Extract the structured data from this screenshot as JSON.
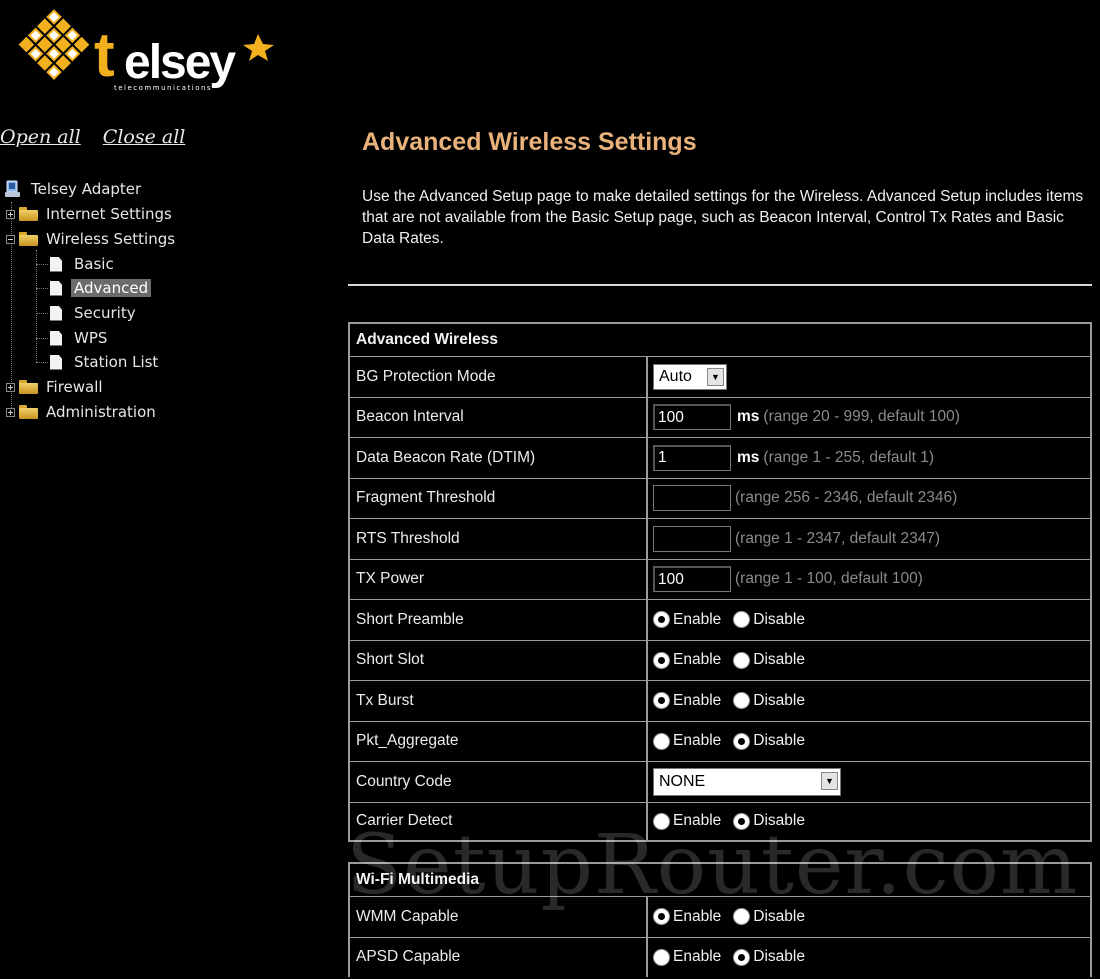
{
  "brand": {
    "name": "Telsey",
    "tagline": "telecommunications"
  },
  "tree": {
    "open_all": "Open all",
    "close_all": "Close all",
    "root": "Telsey Adapter",
    "internet_settings": "Internet Settings",
    "wireless_settings": "Wireless Settings",
    "wireless_children": [
      "Basic",
      "Advanced",
      "Security",
      "WPS",
      "Station List"
    ],
    "firewall": "Firewall",
    "administration": "Administration",
    "selected": "Advanced"
  },
  "page": {
    "title": "Advanced Wireless Settings",
    "description": "Use the Advanced Setup page to make detailed settings for the Wireless. Advanced Setup includes items that are not available from the Basic Setup page, such as Beacon Interval, Control Tx Rates and Basic Data Rates."
  },
  "advanced": {
    "header": "Advanced Wireless",
    "bg_protection": {
      "label": "BG Protection Mode",
      "value": "Auto"
    },
    "beacon_interval": {
      "label": "Beacon Interval",
      "value": "100",
      "unit": "ms",
      "hint": "(range 20 - 999, default 100)"
    },
    "dtim": {
      "label": "Data Beacon Rate (DTIM)",
      "value": "1",
      "unit": "ms",
      "hint": "(range 1 - 255, default 1)"
    },
    "fragment": {
      "label": "Fragment Threshold",
      "value": "",
      "hint": "(range 256 - 2346, default 2346)"
    },
    "rts": {
      "label": "RTS Threshold",
      "value": "",
      "hint": "(range 1 - 2347, default 2347)"
    },
    "tx_power": {
      "label": "TX Power",
      "value": "100",
      "hint": "(range 1 - 100, default 100)"
    },
    "short_preamble": {
      "label": "Short Preamble",
      "selected": "enable"
    },
    "short_slot": {
      "label": "Short Slot",
      "selected": "enable"
    },
    "tx_burst": {
      "label": "Tx Burst",
      "selected": "enable"
    },
    "pkt_aggregate": {
      "label": "Pkt_Aggregate",
      "selected": "disable"
    },
    "country_code": {
      "label": "Country Code",
      "value": "NONE"
    },
    "carrier_detect": {
      "label": "Carrier Detect",
      "selected": "disable"
    }
  },
  "wmm": {
    "header": "Wi-Fi Multimedia",
    "wmm_capable": {
      "label": "WMM Capable",
      "selected": "enable"
    },
    "apsd_capable": {
      "label": "APSD Capable",
      "selected": "disable"
    }
  },
  "radio": {
    "enable": "Enable",
    "disable": "Disable"
  },
  "watermark": "SetupRouter.com",
  "colors": {
    "title": "#e8b27a",
    "logo_yellow": "#f2b01e",
    "background": "#000000"
  }
}
